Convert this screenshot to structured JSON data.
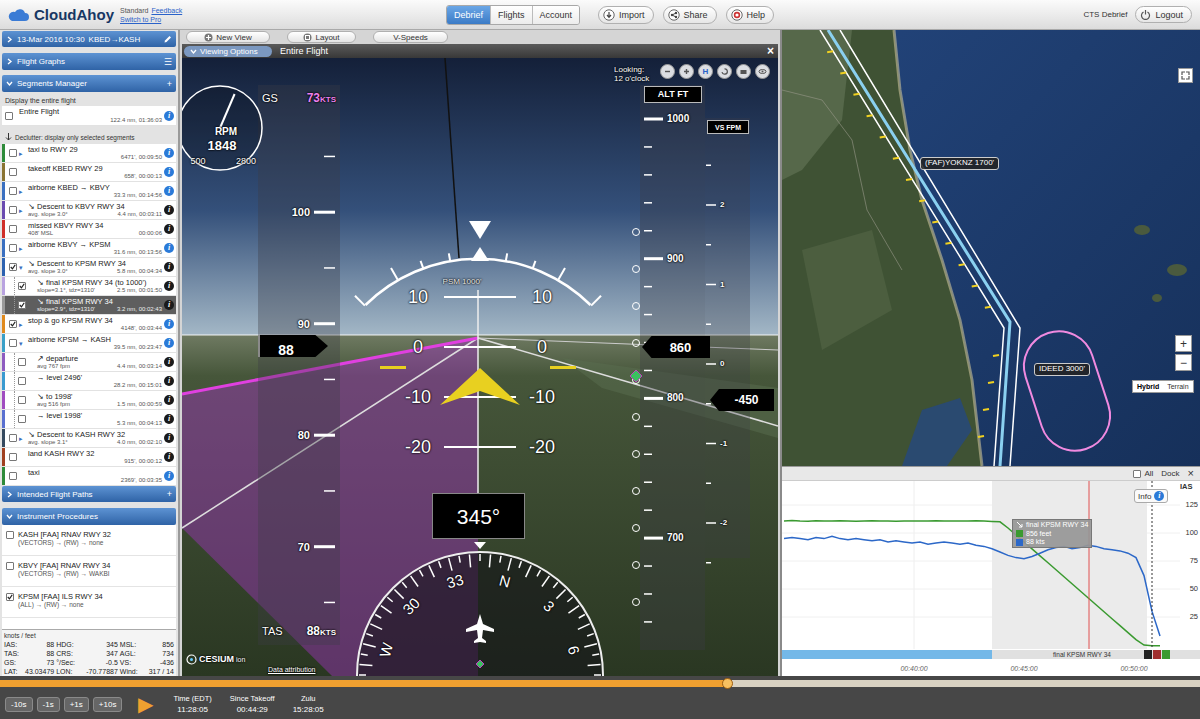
{
  "topbar": {
    "logo": "CloudAhoy",
    "plan": "Standard",
    "links": [
      "Feedback",
      "Switch to Pro"
    ],
    "tabs": [
      {
        "label": "Debrief",
        "selected": true
      },
      {
        "label": "Flights",
        "selected": false
      },
      {
        "label": "Account",
        "selected": false
      }
    ],
    "actions": [
      "Import",
      "Share",
      "Help"
    ],
    "user": "CTS Debrief",
    "logout": "Logout"
  },
  "toolbar": {
    "buttons": [
      "New View",
      "Layout",
      "V-Speeds"
    ]
  },
  "sidebar": {
    "date": "13-Mar 2016 10:30",
    "route": "KBED→KASH",
    "flight_graphs": "Flight Graphs",
    "graphs_menu": "☰",
    "segments_manager": "Segments Manager",
    "add_glyph": "+",
    "info_glyph": "i",
    "glyphs": {
      "expanded": "▾",
      "collapsed": "▸"
    },
    "display_label": "Display the entire flight",
    "entire_flight": {
      "title": "Entire Flight",
      "value": "122.4 nm, 01:36:03",
      "checked": false,
      "info_color": "#2a7ad8"
    },
    "declutter": "Declutter: display only selected segments",
    "segments": [
      {
        "title": "taxi to RWY 29",
        "value": "6471', 00:09:50",
        "color": "#2e8b3a",
        "checked": false,
        "selected": false,
        "expandable": true,
        "expanded": false,
        "child": false,
        "info_color": "#2a7ad8"
      },
      {
        "title": "takeoff KBED RWY 29",
        "value": "658', 00:00:13",
        "color": "#8a7432",
        "checked": false,
        "selected": false,
        "expandable": false,
        "child": false,
        "info_color": "#2a7ad8"
      },
      {
        "title": "airborne KBED → KBVY",
        "value": "33.3 nm, 00:14:56",
        "color": "#3a6fc0",
        "checked": false,
        "selected": false,
        "expandable": true,
        "expanded": false,
        "child": false,
        "info_color": "#2a7ad8"
      },
      {
        "title": "↘ Descent to KBVY RWY 34",
        "sub": "avg. slope 3.0°",
        "value": "4.4 nm, 00:03:11",
        "color": "#6a4ab0",
        "checked": false,
        "selected": false,
        "expandable": true,
        "expanded": false,
        "child": false,
        "info_color": "#1a1a1a"
      },
      {
        "title": "missed KBVY RWY 34",
        "sub": "408' MSL",
        "value": "00:00:06",
        "color": "#d0302a",
        "checked": false,
        "selected": false,
        "expandable": false,
        "child": false,
        "info_color": "#1a1a1a"
      },
      {
        "title": "airborne KBVY → KPSM",
        "value": "31.6 nm, 00:13:56",
        "color": "#3a6fc0",
        "checked": false,
        "selected": false,
        "expandable": true,
        "expanded": false,
        "child": false,
        "info_color": "#2a7ad8"
      },
      {
        "title": "↘ Descent to KPSM RWY 34",
        "sub": "avg. slope 3.0°",
        "value": "5.8 nm, 00:04:34",
        "color": "#2d62b0",
        "checked": true,
        "selected": false,
        "expandable": true,
        "expanded": true,
        "child": false,
        "info_color": "#1a1a1a"
      },
      {
        "title": "↘ final KPSM RWY 34 (to 1000')",
        "sub": "slope=3.1°, tdz=1310'",
        "value": "2.5 nm, 00:01:50",
        "color": "#b9a3e0",
        "checked": true,
        "selected": false,
        "expandable": false,
        "child": true,
        "info_color": "#1a1a1a"
      },
      {
        "title": "↘ final KPSM RWY 34",
        "sub": "slope=2.9°, tdz=1310'",
        "value": "3.2 nm, 00:02:43",
        "color": "#9a9a9a",
        "checked": true,
        "selected": true,
        "expandable": false,
        "child": true,
        "info_color": "#1a1a1a"
      },
      {
        "title": "stop & go KPSM RWY 34",
        "value": "4148', 00:03:44",
        "color": "#e08a1e",
        "checked": true,
        "selected": false,
        "expandable": true,
        "expanded": false,
        "child": false,
        "info_color": "#2a7ad8"
      },
      {
        "title": "airborne KPSM → KASH",
        "value": "39.5 nm, 00:23:47",
        "color": "#3aa0c8",
        "checked": false,
        "selected": false,
        "expandable": true,
        "expanded": true,
        "child": false,
        "info_color": "#2a7ad8"
      },
      {
        "title": "↗ departure",
        "sub": "avg 767 fpm",
        "value": "4.4 nm, 00:03:14",
        "color": "#8e5cc0",
        "checked": false,
        "selected": false,
        "expandable": false,
        "child": true,
        "info_color": "#1a1a1a"
      },
      {
        "title": "→ level 2496'",
        "value": "28.2 nm, 00:15:01",
        "color": "#3a9ad0",
        "checked": false,
        "selected": false,
        "expandable": false,
        "child": true,
        "info_color": "#1a1a1a"
      },
      {
        "title": "↘ to 1998'",
        "sub": "avg 516 fpm",
        "value": "1.5 nm, 00:00:59",
        "color": "#a04cc0",
        "checked": false,
        "selected": false,
        "expandable": false,
        "child": true,
        "info_color": "#1a1a1a"
      },
      {
        "title": "→ level 1998'",
        "value": "5.3 nm, 00:04:13",
        "color": "#5a70d0",
        "checked": false,
        "selected": false,
        "expandable": false,
        "child": true,
        "info_color": "#1a1a1a"
      },
      {
        "title": "↘ Descent to KASH RWY 32",
        "sub": "avg. slope 3.1°",
        "value": "4.0 nm, 00:02:10",
        "color": "#34495e",
        "checked": false,
        "selected": false,
        "expandable": true,
        "expanded": false,
        "child": false,
        "info_color": "#1a1a1a"
      },
      {
        "title": "land KASH RWY 32",
        "value": "915', 00:00:12",
        "color": "#a04020",
        "checked": false,
        "selected": false,
        "expandable": false,
        "child": false,
        "info_color": "#1a1a1a"
      },
      {
        "title": "taxi",
        "value": "2369', 00:03:35",
        "color": "#2e8b3a",
        "checked": false,
        "selected": false,
        "expandable": false,
        "child": false,
        "info_color": "#2a7ad8"
      }
    ],
    "intended": "Intended Flight Paths",
    "procedures_title": "Instrument Procedures",
    "procedures": [
      {
        "title": "KASH [FAA] RNAV RWY 32",
        "route": "(VECTORS) → (RW) → none",
        "checked": false
      },
      {
        "title": "KBVY [FAA] RNAV RWY 34",
        "route": "(VECTORS) → (RW) → WAKBI",
        "checked": false
      },
      {
        "title": "KPSM [FAA] ILS RWY 34",
        "route": "(ALL) → (RW) → none",
        "checked": true
      }
    ],
    "data": {
      "unit": "knots / feet",
      "rows": [
        [
          [
            "IAS:",
            "88"
          ],
          [
            "HDG:",
            "345"
          ],
          [
            "MSL:",
            "856"
          ]
        ],
        [
          [
            "TAS:",
            "88"
          ],
          [
            "CRS:",
            "347"
          ],
          [
            "AGL:",
            "734"
          ]
        ],
        [
          [
            "GS:",
            "73"
          ],
          [
            "°/Sec:",
            "-0.5"
          ],
          [
            "VS:",
            "-436"
          ]
        ],
        [
          [
            "LAT:",
            "43.03479"
          ],
          [
            "LON:",
            "-70.77887"
          ],
          [
            "Wind:",
            "317 / 14"
          ]
        ]
      ]
    }
  },
  "view": {
    "options": "Viewing Options",
    "title": "Entire Flight",
    "close": "×",
    "looking": [
      "Looking:",
      "12 o'clock"
    ],
    "home": "H",
    "rpm": {
      "label": "RPM",
      "value": "1848",
      "min": "500",
      "max": "2800",
      "level": 0.586
    },
    "gs": {
      "label": "GS",
      "value": "73",
      "unit": "KTS"
    },
    "tas": {
      "label": "TAS",
      "value": "88",
      "unit": "KTS"
    },
    "speed_ticks": [
      "100",
      "90",
      "80",
      "70"
    ],
    "speed": "88",
    "alt_title": "ALT FT",
    "alt_ticks": [
      "1000",
      "900",
      "800",
      "700"
    ],
    "alt": "860",
    "vs_title": "VS FPM",
    "vs_ticks": [
      "2",
      "1",
      "0",
      "-1",
      "-2"
    ],
    "vs": "-450",
    "pitch": [
      [
        "10",
        "10"
      ],
      [
        "0",
        "0"
      ],
      [
        "-10",
        "-10"
      ],
      [
        "-20",
        "-20"
      ]
    ],
    "glide": "PSM 1000'",
    "heading": "345°",
    "compass": [
      "W",
      "30",
      "33",
      "N",
      "3",
      "6"
    ],
    "credit": {
      "brand": "CESIUM",
      "suffix": "ion",
      "link": "Data attribution"
    }
  },
  "map": {
    "waypoints": [
      {
        "label": "(FAF)YOKNZ 1700'"
      },
      {
        "label": "IDEED 3000'"
      }
    ],
    "zoom_in": "+",
    "zoom_out": "−",
    "types": [
      {
        "label": "Hybrid",
        "selected": true
      },
      {
        "label": "Terrain",
        "selected": false
      }
    ]
  },
  "graph": {
    "all": {
      "label": "All",
      "checked": false
    },
    "dock": "Dock",
    "close": "×",
    "info": "Info",
    "axis_label": "IAS",
    "y_ticks": [
      "125",
      "100",
      "75",
      "50",
      "25"
    ],
    "x_ticks": [
      "00:40:00",
      "00:45:00",
      "00:50:00"
    ],
    "tooltip": {
      "title": "final KPSM RWY 34",
      "rows": [
        {
          "text": "856 feet",
          "color": "#3a9a30"
        },
        {
          "text": "88 kts",
          "color": "#2c68c8"
        }
      ]
    },
    "segment_label": "final KPSM RWY 34",
    "series": [
      {
        "color": "#3a9a30",
        "values": [
          1700,
          1705,
          1700,
          1698,
          1702,
          1700,
          1700,
          1703,
          1700,
          1697,
          1700,
          1702,
          1700,
          1700,
          1698,
          1700,
          1701,
          1700,
          1700,
          1702,
          1700,
          1699,
          1700,
          1700,
          1702,
          1700,
          1695,
          1690,
          1610,
          1520,
          1430,
          1340,
          1250,
          1160,
          1070,
          980,
          890,
          800,
          710,
          620,
          530,
          440,
          350,
          260,
          170,
          100,
          90,
          90
        ]
      },
      {
        "color": "#2c68c8",
        "values": [
          95,
          96,
          95,
          94,
          96,
          95,
          97,
          95,
          94,
          95,
          94,
          93,
          94,
          92,
          93,
          92,
          91,
          92,
          90,
          91,
          92,
          91,
          90,
          91,
          89,
          88,
          86,
          83,
          80,
          78,
          77,
          79,
          82,
          85,
          87,
          88,
          86,
          87,
          89,
          88,
          86,
          85,
          84,
          82,
          78,
          62,
          30,
          8
        ]
      }
    ]
  },
  "player": {
    "steps": [
      "-10s",
      "-1s",
      "+1s",
      "+10s"
    ],
    "play": "▶",
    "level": 0.606,
    "fields": [
      {
        "label": "Time (EDT)",
        "value": "11:28:05"
      },
      {
        "label": "Since Takeoff",
        "value": "00:44:29"
      },
      {
        "label": "Zulu",
        "value": "15:28:05"
      }
    ]
  }
}
